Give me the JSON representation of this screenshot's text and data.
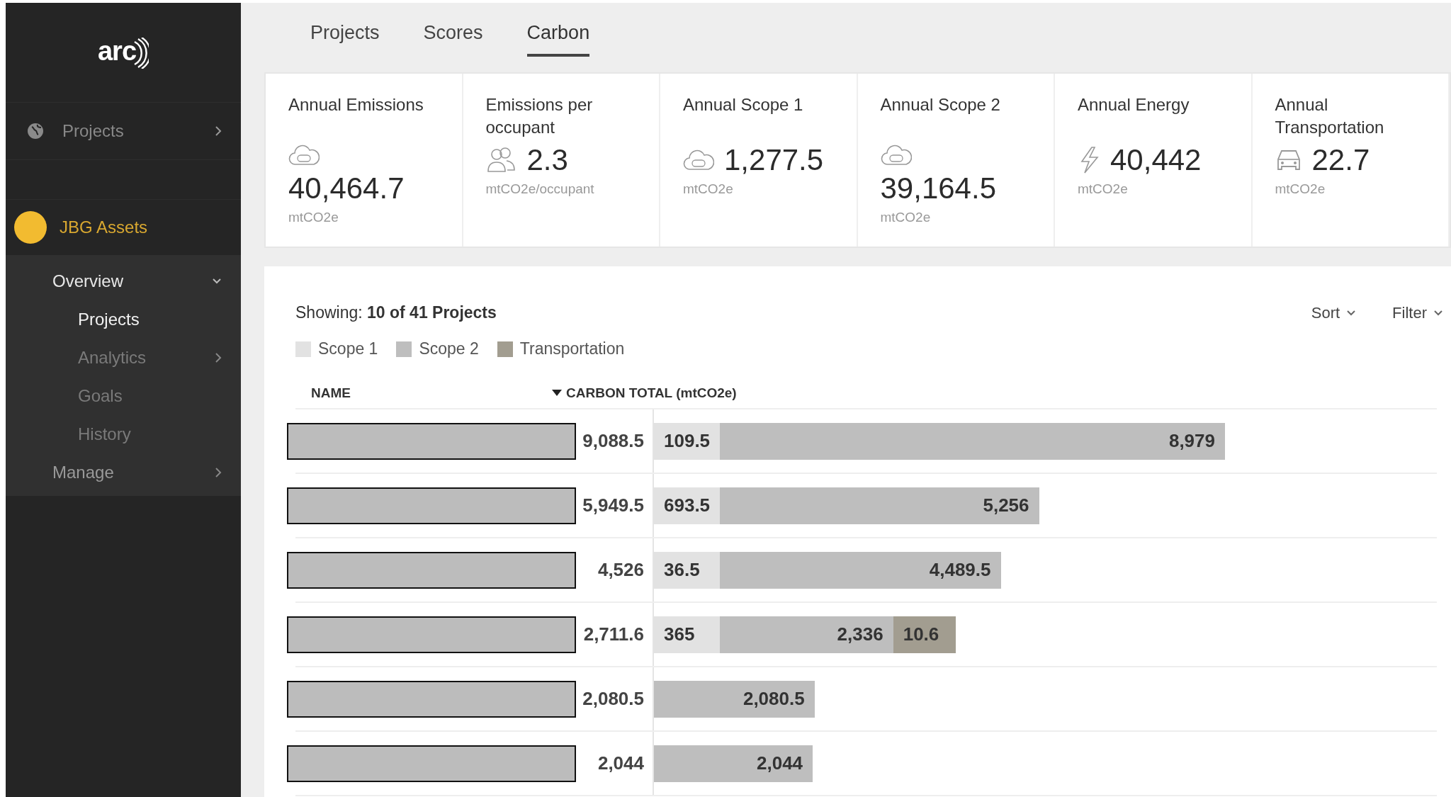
{
  "sidebar": {
    "logo": "arc",
    "nav": [
      {
        "label": "Projects",
        "expanded": false
      }
    ],
    "portfolio": {
      "name": "JBG Assets"
    },
    "menu": [
      {
        "label": "Overview",
        "kind": "group",
        "expanded": true,
        "children": [
          {
            "label": "Projects",
            "kind": "link",
            "selected": true
          },
          {
            "label": "Analytics",
            "kind": "group",
            "expanded": false,
            "selected": false
          },
          {
            "label": "Goals",
            "kind": "link",
            "selected": false
          },
          {
            "label": "History",
            "kind": "link",
            "selected": false
          }
        ]
      },
      {
        "label": "Manage",
        "kind": "group",
        "expanded": false
      }
    ]
  },
  "tabs": [
    {
      "label": "Projects",
      "selected": false
    },
    {
      "label": "Scores",
      "selected": false
    },
    {
      "label": "Carbon",
      "selected": true
    }
  ],
  "cards": [
    {
      "title": "Annual Emissions",
      "kind": "stacked-cloud",
      "value": "40,464.7",
      "unit": "mtCO2e"
    },
    {
      "title": "Emissions per occupant",
      "kind": "people",
      "value": "2.3",
      "unit": "mtCO2e/occupant"
    },
    {
      "title": "Annual Scope 1",
      "kind": "cloud",
      "value": "1,277.5",
      "unit": "mtCO2e"
    },
    {
      "title": "Annual Scope 2",
      "kind": "stacked-cloud",
      "value": "39,164.5",
      "unit": "mtCO2e"
    },
    {
      "title": "Annual Energy",
      "kind": "bolt",
      "value": "40,442",
      "unit": "mtCO2e"
    },
    {
      "title": "Annual Transportation",
      "kind": "car",
      "value": "22.7",
      "unit": "mtCO2e"
    }
  ],
  "panel": {
    "showing": "Showing: **10 of 41 Projects**",
    "controls": [
      "Sort",
      "Filter"
    ],
    "legend": [
      {
        "label": "Scope 1",
        "kind": "scope1",
        "color": "#e2e2e2"
      },
      {
        "label": "Scope 2",
        "kind": "scope2",
        "color": "#bebebe"
      },
      {
        "label": "Transportation",
        "kind": "transportation",
        "color": "#a29d90"
      }
    ],
    "columns": [
      {
        "label": "NAME",
        "sorted": false
      },
      {
        "label": "CARBON TOTAL (mtCO2e)",
        "sorted": true
      }
    ],
    "rows": [
      {
        "total": "9,088.5",
        "segments": [
          {
            "kind": "scope1",
            "label": "109.5"
          },
          {
            "kind": "scope2",
            "label": "8,979"
          }
        ]
      },
      {
        "total": "5,949.5",
        "segments": [
          {
            "kind": "scope1",
            "label": "693.5"
          },
          {
            "kind": "scope2",
            "label": "5,256"
          }
        ]
      },
      {
        "total": "4,526",
        "segments": [
          {
            "kind": "scope1",
            "label": "36.5"
          },
          {
            "kind": "scope2",
            "label": "4,489.5"
          }
        ]
      },
      {
        "total": "2,711.6",
        "segments": [
          {
            "kind": "scope1",
            "label": "365"
          },
          {
            "kind": "scope2",
            "label": "2,336"
          },
          {
            "kind": "transportation",
            "label": "10.6"
          }
        ]
      },
      {
        "total": "2,080.5",
        "segments": [
          {
            "kind": "scope2",
            "label": "2,080.5"
          }
        ]
      },
      {
        "total": "2,044",
        "segments": [
          {
            "kind": "scope2",
            "label": "2,044"
          }
        ]
      }
    ]
  }
}
